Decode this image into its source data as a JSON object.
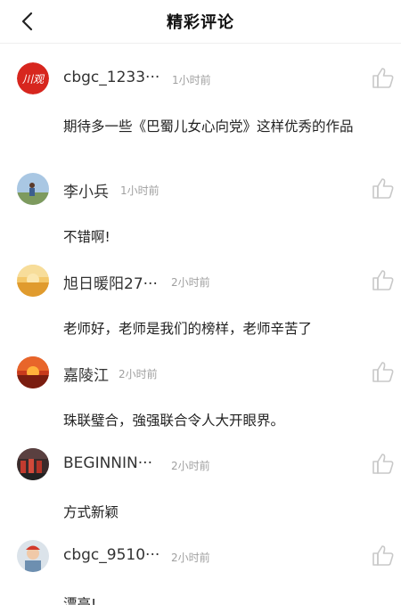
{
  "header": {
    "title": "精彩评论",
    "back_icon": "chevron-left-icon"
  },
  "comments": [
    {
      "username": "cbgc_1233···",
      "time": "1小时前",
      "content": "期待多一些《巴蜀儿女心向党》这样优秀的作品",
      "avatar_text": "川观"
    },
    {
      "username": "李小兵",
      "time": "1小时前",
      "content": "不错啊!"
    },
    {
      "username": "旭日暖阳27···",
      "time": "2小时前",
      "content": "老师好，老师是我们的榜样，老师辛苦了"
    },
    {
      "username": "嘉陵江",
      "time": "2小时前",
      "content": "珠联璧合，強强联合令人大开眼界。"
    },
    {
      "username": "BEGINNIN···",
      "time": "2小时前",
      "content": "方式新颖"
    },
    {
      "username": "cbgc_9510···",
      "time": "2小时前",
      "content": "漂亮!"
    }
  ],
  "icons": {
    "like": "thumbs-up-icon"
  },
  "colors": {
    "brand_red": "#d7261e",
    "time_gray": "#a0a0a0",
    "icon_gray": "#c8c8c8"
  }
}
